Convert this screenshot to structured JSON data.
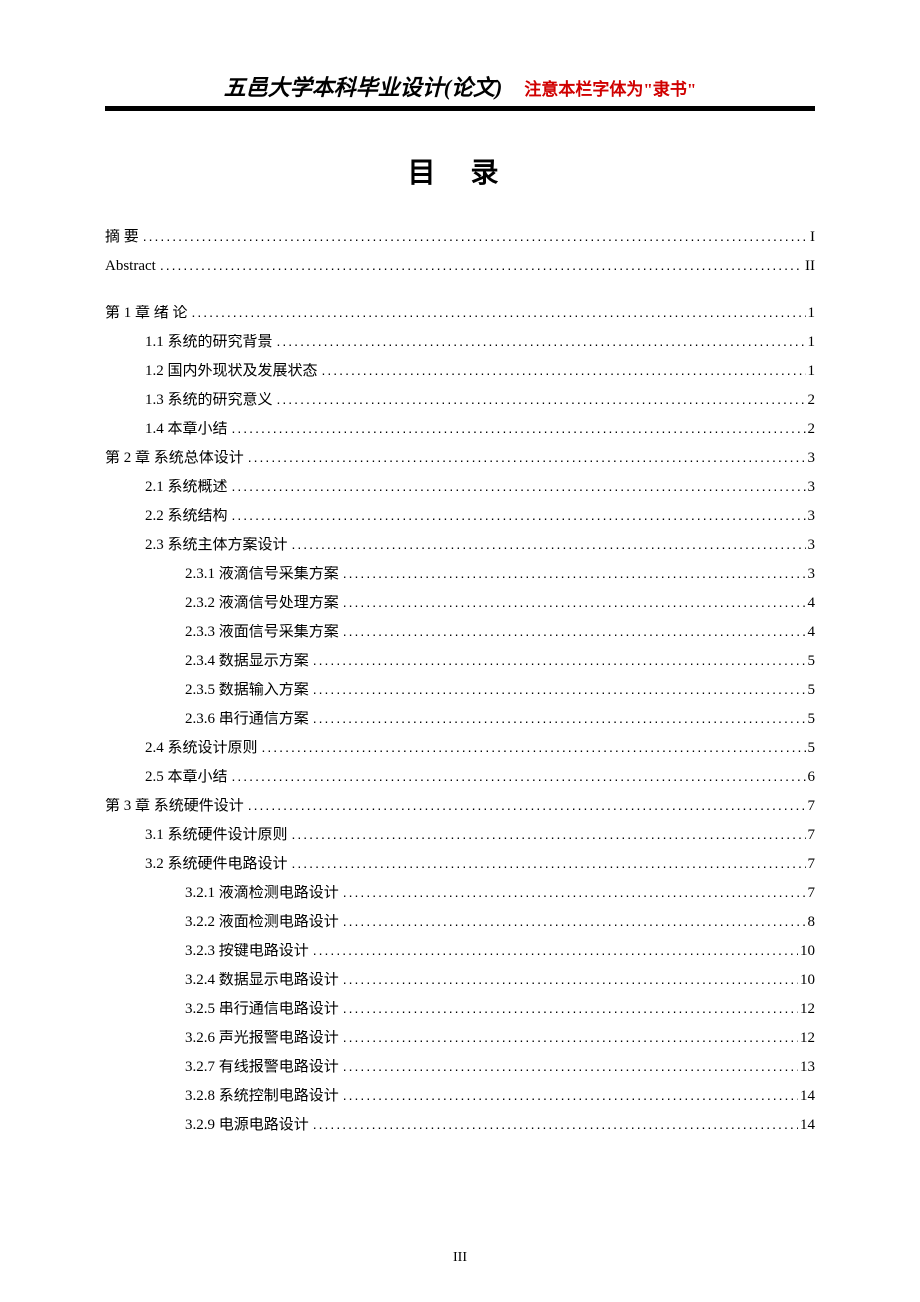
{
  "header": {
    "title": "五邑大学本科毕业设计(论文)",
    "note": "注意本栏字体为\"隶书\""
  },
  "toc_title": "目  录",
  "toc": [
    {
      "level": 0,
      "label": "摘  要",
      "page": "I"
    },
    {
      "level": 0,
      "label": "Abstract",
      "page": "II"
    },
    {
      "gap": true
    },
    {
      "level": 0,
      "label": "第 1 章  绪  论",
      "page": "1"
    },
    {
      "level": 1,
      "label": "1.1  系统的研究背景",
      "page": "1"
    },
    {
      "level": 1,
      "label": "1.2  国内外现状及发展状态",
      "page": "1"
    },
    {
      "level": 1,
      "label": "1.3  系统的研究意义",
      "page": "2"
    },
    {
      "level": 1,
      "label": "1.4  本章小结",
      "page": "2"
    },
    {
      "level": 0,
      "label": "第 2 章  系统总体设计",
      "page": "3"
    },
    {
      "level": 1,
      "label": "2.1  系统概述",
      "page": "3"
    },
    {
      "level": 1,
      "label": "2.2  系统结构",
      "page": "3"
    },
    {
      "level": 1,
      "label": "2.3  系统主体方案设计",
      "page": "3"
    },
    {
      "level": 2,
      "label": "2.3.1  液滴信号采集方案",
      "page": "3"
    },
    {
      "level": 2,
      "label": "2.3.2  液滴信号处理方案",
      "page": "4"
    },
    {
      "level": 2,
      "label": "2.3.3  液面信号采集方案",
      "page": "4"
    },
    {
      "level": 2,
      "label": "2.3.4  数据显示方案",
      "page": "5"
    },
    {
      "level": 2,
      "label": "2.3.5  数据输入方案",
      "page": "5"
    },
    {
      "level": 2,
      "label": "2.3.6  串行通信方案",
      "page": "5"
    },
    {
      "level": 1,
      "label": "2.4  系统设计原则",
      "page": "5"
    },
    {
      "level": 1,
      "label": "2.5 本章小结",
      "page": "6"
    },
    {
      "level": 0,
      "label": "第 3 章  系统硬件设计",
      "page": "7"
    },
    {
      "level": 1,
      "label": "3.1  系统硬件设计原则",
      "page": "7"
    },
    {
      "level": 1,
      "label": "3.2  系统硬件电路设计",
      "page": "7"
    },
    {
      "level": 2,
      "label": "3.2.1  液滴检测电路设计",
      "page": "7"
    },
    {
      "level": 2,
      "label": "3.2.2 液面检测电路设计",
      "page": "8"
    },
    {
      "level": 2,
      "label": "3.2.3  按键电路设计",
      "page": "10"
    },
    {
      "level": 2,
      "label": "3.2.4  数据显示电路设计",
      "page": "10"
    },
    {
      "level": 2,
      "label": "3.2.5  串行通信电路设计",
      "page": "12"
    },
    {
      "level": 2,
      "label": "3.2.6  声光报警电路设计",
      "page": "12"
    },
    {
      "level": 2,
      "label": "3.2.7  有线报警电路设计",
      "page": "13"
    },
    {
      "level": 2,
      "label": "3.2.8  系统控制电路设计",
      "page": "14"
    },
    {
      "level": 2,
      "label": "3.2.9  电源电路设计",
      "page": "14"
    }
  ],
  "page_number": "III"
}
